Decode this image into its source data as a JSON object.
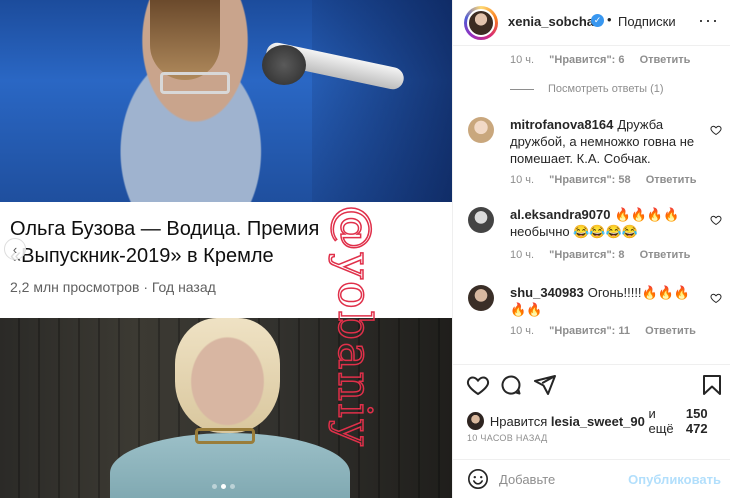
{
  "media": {
    "youtube_card": {
      "title": "Ольга Бузова — Водица. Премия «Выпускник-2019» в Кремле",
      "meta": "2,2 млн просмотров · Год назад"
    },
    "carousel_prev_icon": "chevron-left-icon",
    "carousel": {
      "total": 3,
      "active": 1
    }
  },
  "post_header": {
    "username": "xenia_sobchak",
    "verified_icon": "verified-badge-icon",
    "separator": "•",
    "follow_label": "Подписки",
    "more_icon": "more-options-icon"
  },
  "comments": {
    "top_meta": {
      "time": "10 ч.",
      "likes": "\"Нравится\": 6",
      "reply": "Ответить"
    },
    "view_replies": "Посмотреть ответы (1)",
    "items": [
      {
        "username": "mitrofanova8164",
        "text": "Дружба дружбой, а немножко говна не помешает. К.А. Собчак.",
        "time": "10 ч.",
        "likes": "\"Нравится\": 58",
        "reply": "Ответить"
      },
      {
        "username": "al.eksandra9070",
        "text": "🔥🔥🔥🔥 необычно 😂😂😂😂",
        "time": "10 ч.",
        "likes": "\"Нравится\": 8",
        "reply": "Ответить"
      },
      {
        "username": "shu_340983",
        "text": "Огонь!!!!!🔥🔥🔥🔥🔥",
        "time": "10 ч.",
        "likes": "\"Нравится\": 11",
        "reply": "Ответить"
      }
    ]
  },
  "actions": {
    "like_icon": "heart-icon",
    "comment_icon": "comment-icon",
    "share_icon": "share-icon",
    "save_icon": "bookmark-icon"
  },
  "likes_summary": {
    "prefix": "Нравится",
    "user": "lesia_sweet_90",
    "middle": "и ещё",
    "count": "150 472"
  },
  "time_ago": "10 ЧАСОВ НАЗАД",
  "add_comment": {
    "emoji_icon": "emoji-icon",
    "placeholder": "Добавьте",
    "publish_label": "Опубликовать"
  },
  "colors": {
    "link_disabled": "#b2dffc",
    "verified": "#3897f0",
    "muted": "#8e8e8e",
    "text": "#262626"
  }
}
